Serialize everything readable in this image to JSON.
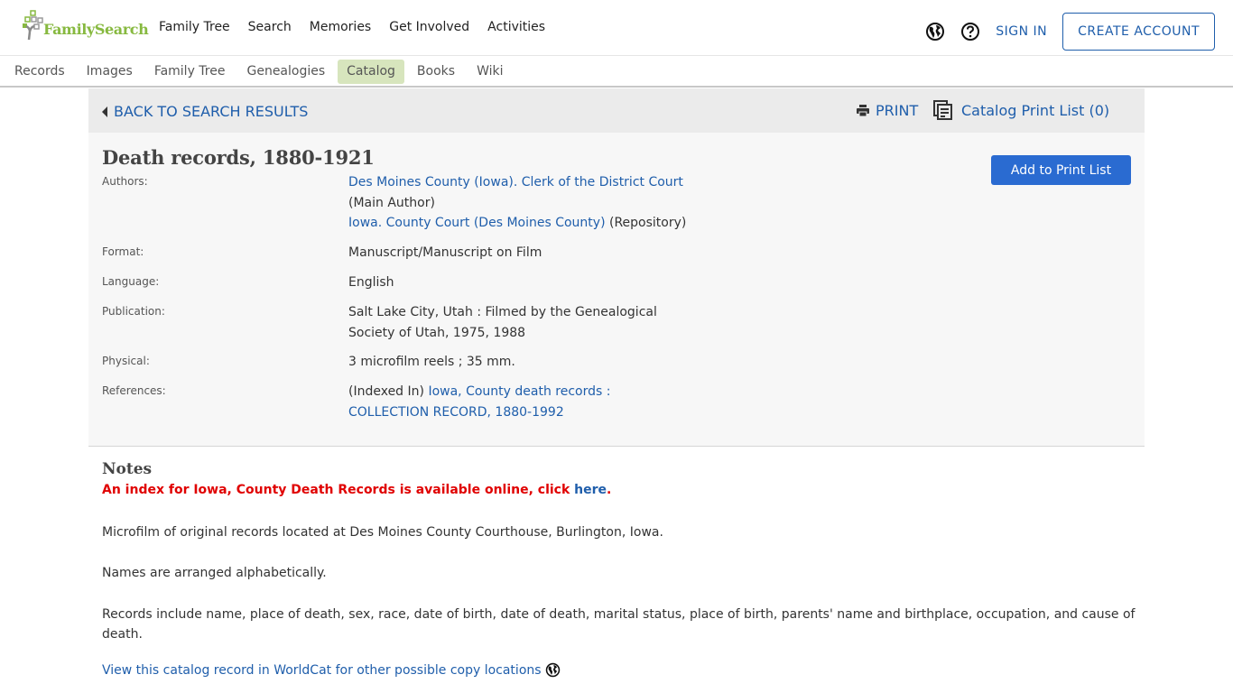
{
  "brand": {
    "name": "FamilySearch",
    "color": "#87b940"
  },
  "primary_nav": [
    "Family Tree",
    "Search",
    "Memories",
    "Get Involved",
    "Activities"
  ],
  "utility": {
    "language_icon": "globe-icon",
    "help_icon": "help-circle-icon",
    "sign_in": "SIGN IN",
    "create_account": "CREATE ACCOUNT"
  },
  "secondary_nav": {
    "items": [
      "Records",
      "Images",
      "Family Tree",
      "Genealogies",
      "Catalog",
      "Books",
      "Wiki"
    ],
    "active": "Catalog"
  },
  "actions": {
    "back": "BACK TO SEARCH RESULTS",
    "print": "PRINT",
    "print_list": "Catalog Print List (0)",
    "add_to_print_list": "Add to Print List"
  },
  "record": {
    "title": "Death records, 1880-1921",
    "fields": {
      "authors": {
        "label": "Authors:",
        "main_author_link": "Des Moines County (Iowa). Clerk of the District Court",
        "main_author_role": "(Main Author)",
        "repository_link": "Iowa. County Court (Des Moines County)",
        "repository_role": "(Repository)"
      },
      "format": {
        "label": "Format:",
        "value": "Manuscript/Manuscript on Film"
      },
      "language": {
        "label": "Language:",
        "value": "English"
      },
      "publication": {
        "label": "Publication:",
        "line1": "Salt Lake City, Utah : Filmed by the Genealogical",
        "line2": "Society of Utah, 1975, 1988"
      },
      "physical": {
        "label": "Physical:",
        "value": "3 microfilm reels ; 35 mm."
      },
      "references": {
        "label": "References:",
        "prefix": "(Indexed In)",
        "link_line1": "Iowa, County death records :",
        "link_line2": "COLLECTION RECORD, 1880-1992"
      }
    }
  },
  "notes": {
    "heading": "Notes",
    "alert_text": "An index for Iowa, County Death Records is available online, click ",
    "alert_link": "here",
    "alert_end": ".",
    "paragraphs": [
      "Microfilm of original records located at Des Moines County Courthouse, Burlington, Iowa.",
      "Names are arranged alphabetically.",
      "Records include name, place of death, sex, race, date of birth, date of death, marital status, place of birth, parents' name and birthplace, occupation, and cause of death."
    ],
    "worldcat_link": "View this catalog record in WorldCat for other possible copy locations"
  }
}
